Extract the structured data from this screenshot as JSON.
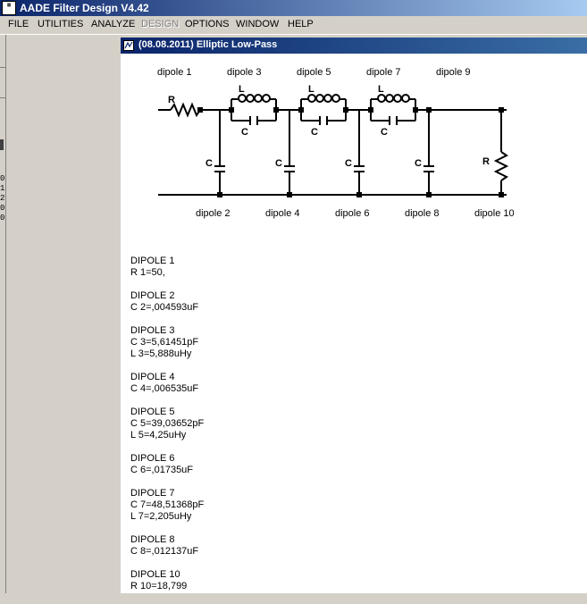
{
  "app": {
    "title": "AADE Filter Design V4.42"
  },
  "menu": [
    {
      "label": "FILE",
      "enabled": true
    },
    {
      "label": "UTILITIES",
      "enabled": true
    },
    {
      "label": "ANALYZE",
      "enabled": true
    },
    {
      "label": "DESIGN",
      "enabled": false
    },
    {
      "label": "OPTIONS",
      "enabled": true
    },
    {
      "label": "WINDOW",
      "enabled": true
    },
    {
      "label": "HELP",
      "enabled": true
    }
  ],
  "left_strip": {
    "digits": [
      "0",
      "1",
      "2",
      "0",
      "0"
    ]
  },
  "window": {
    "title": "(08.08.2011) Elliptic Low-Pass"
  },
  "schematic": {
    "top_labels": [
      "dipole  1",
      "dipole  3",
      "dipole  5",
      "dipole  7",
      "dipole  9"
    ],
    "bottom_labels": [
      "dipole  2",
      "dipole  4",
      "dipole  6",
      "dipole  8",
      "dipole  10"
    ],
    "component_letters": {
      "r": "R",
      "l": "L",
      "c": "C"
    }
  },
  "results": [
    {
      "header": "DIPOLE 1",
      "lines": [
        "R 1=50,"
      ]
    },
    {
      "header": "DIPOLE 2",
      "lines": [
        "C 2=,004593uF"
      ]
    },
    {
      "header": "DIPOLE 3",
      "lines": [
        "C 3=5,61451pF",
        "L 3=5,888uHy"
      ]
    },
    {
      "header": "DIPOLE 4",
      "lines": [
        "C 4=,006535uF"
      ]
    },
    {
      "header": "DIPOLE 5",
      "lines": [
        "C 5=39,03652pF",
        "L 5=4,25uHy"
      ]
    },
    {
      "header": "DIPOLE 6",
      "lines": [
        "C 6=,01735uF"
      ]
    },
    {
      "header": "DIPOLE 7",
      "lines": [
        "C 7=48,51368pF",
        "L 7=2,205uHy"
      ]
    },
    {
      "header": "DIPOLE 8",
      "lines": [
        "C 8=,012137uF"
      ]
    },
    {
      "header": "DIPOLE 10",
      "lines": [
        "R 10=18,799"
      ]
    }
  ]
}
